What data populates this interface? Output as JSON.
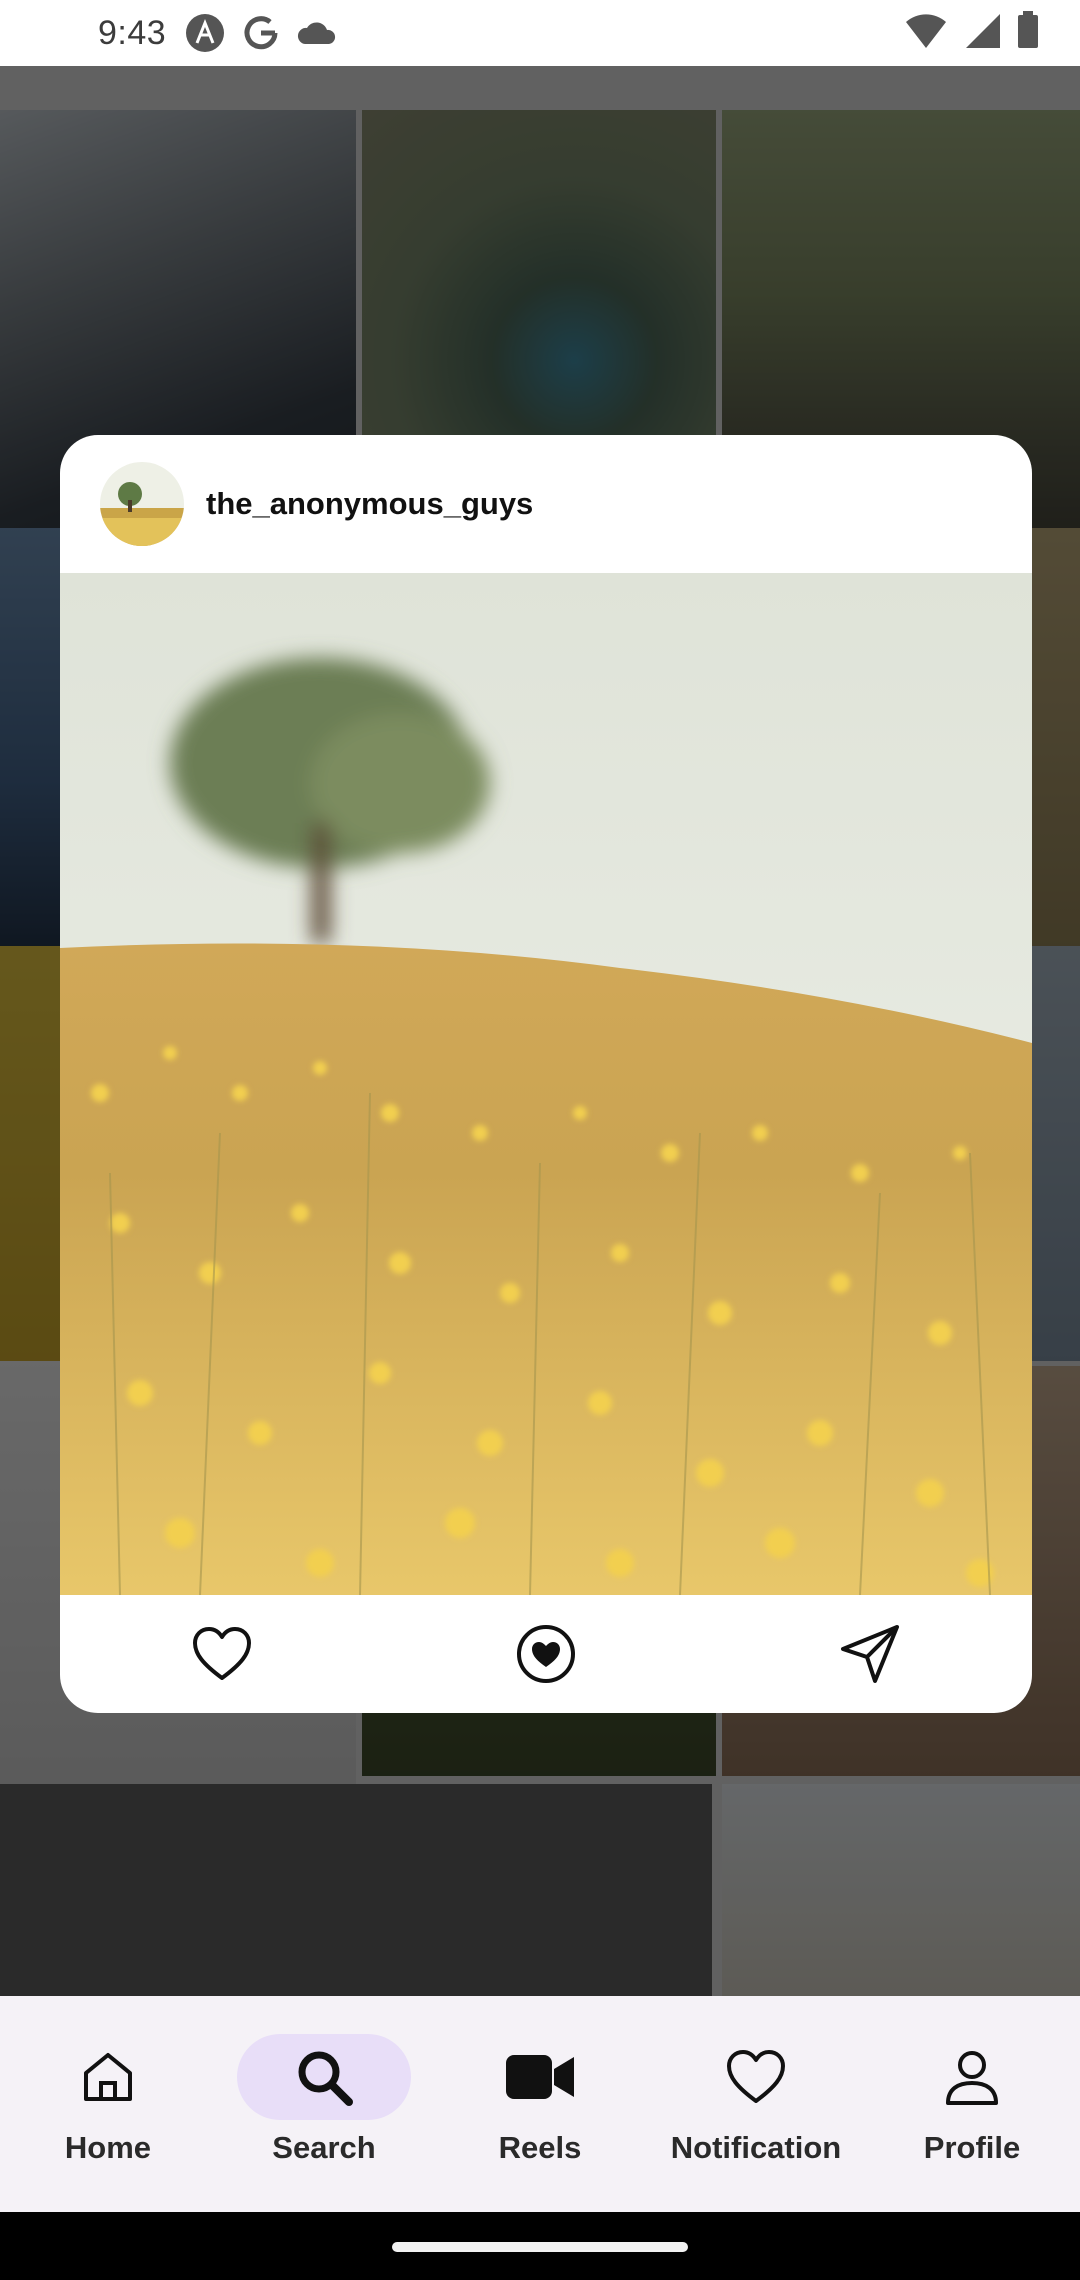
{
  "status_bar": {
    "time": "9:43",
    "left_icons": [
      "a-icon",
      "google-icon",
      "cloud-icon"
    ],
    "right_icons": [
      "wifi-icon",
      "signal-icon",
      "battery-icon"
    ]
  },
  "post_card": {
    "username": "the_anonymous_guys",
    "avatar_icon": "tree-field-avatar",
    "image_description_icon": "field-with-tree-photo",
    "actions": [
      {
        "name": "like",
        "icon": "heart-icon"
      },
      {
        "name": "favorite",
        "icon": "heart-circle-icon"
      },
      {
        "name": "share",
        "icon": "send-icon"
      }
    ]
  },
  "bottom_nav": {
    "items": [
      {
        "label": "Home",
        "icon": "home-icon",
        "active": false
      },
      {
        "label": "Search",
        "icon": "search-icon",
        "active": true
      },
      {
        "label": "Reels",
        "icon": "video-icon",
        "active": false
      },
      {
        "label": "Notification",
        "icon": "heart-icon",
        "active": false
      },
      {
        "label": "Profile",
        "icon": "person-icon",
        "active": false
      }
    ]
  },
  "colors": {
    "nav_background": "#f5f2f7",
    "nav_active_pill": "#e8def8",
    "card_background": "#ffffff"
  }
}
